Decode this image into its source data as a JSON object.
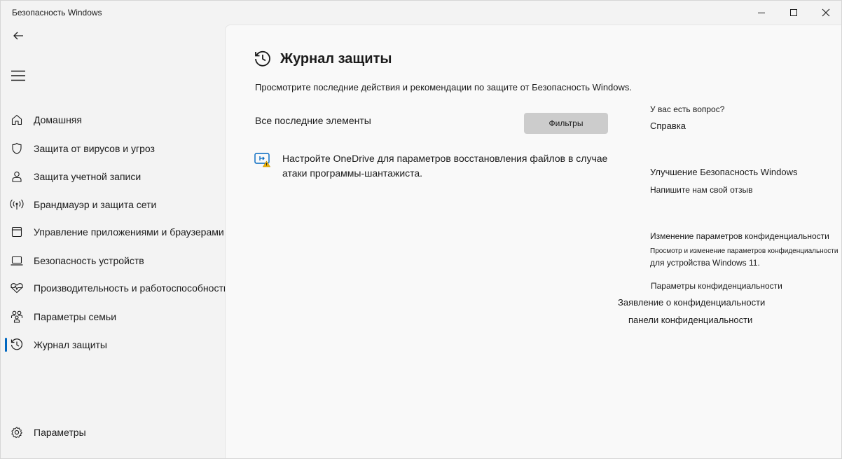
{
  "window": {
    "title": "Безопасность Windows"
  },
  "nav": {
    "items": [
      {
        "label": "Домашняя",
        "icon": "home-icon"
      },
      {
        "label": "Защита от вирусов и угроз",
        "icon": "shield-icon"
      },
      {
        "label": "Защита учетной записи",
        "icon": "person-icon"
      },
      {
        "label": "Брандмауэр и защита сети",
        "icon": "wifi-antenna-icon"
      },
      {
        "label": "Управление приложениями и браузерами",
        "icon": "app-window-icon"
      },
      {
        "label": "Безопасность устройств",
        "icon": "laptop-icon"
      },
      {
        "label": "Производительность и работоспособность устройства",
        "icon": "heart-pulse-icon"
      },
      {
        "label": "Параметры семьи",
        "icon": "family-icon"
      },
      {
        "label": "Журнал защиты",
        "icon": "history-icon",
        "selected": true
      }
    ],
    "settings": {
      "label": "Параметры",
      "icon": "gear-icon"
    }
  },
  "main": {
    "title": "Журнал защиты",
    "subtitle": "Просмотрите последние действия и рекомендации по защите от Безопасность Windows.",
    "recent_label": "Все последние элементы",
    "filters_button": "Фильтры",
    "recommendation": {
      "text": "Настройте OneDrive для параметров восстановления файлов в случае атаки программы-шантажиста.",
      "icon": "onedrive-warning-icon"
    }
  },
  "side": {
    "question_heading": "У вас есть вопрос?",
    "help_link": "Справка",
    "improve_heading": "Улучшение Безопасность Windows",
    "feedback_link": "Напишите нам свой отзыв",
    "privacy_heading": "Изменение параметров конфиденциальности",
    "privacy_desc_line1": "Просмотр и изменение параметров конфиденциальности",
    "privacy_desc_line2": "для устройства Windows 11.",
    "privacy_settings_link": "Параметры конфиденциальности",
    "privacy_statement_link": "Заявление о конфиденциальности",
    "privacy_dashboard_link": "панели конфиденциальности"
  },
  "colors": {
    "accent": "#0067c0",
    "warning": "#f2b400"
  }
}
